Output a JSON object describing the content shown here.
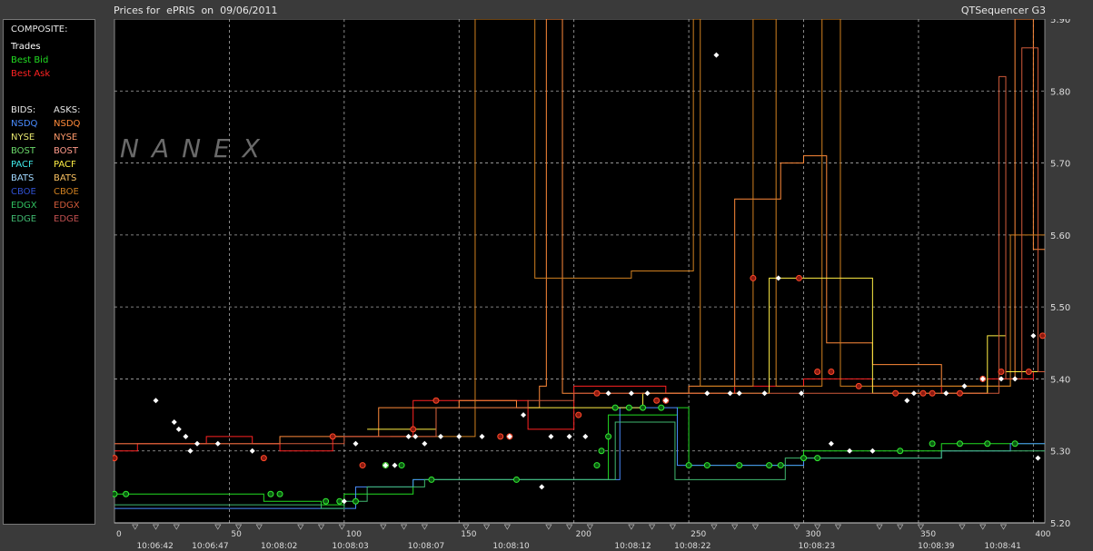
{
  "header": {
    "title": "Prices for  ePRIS  on  09/06/2011",
    "app": "QTSequencer G3"
  },
  "watermark": "NANEX",
  "legend": {
    "composite_title": "COMPOSITE:",
    "composite": [
      {
        "label": "Trades",
        "color": "#ffffff"
      },
      {
        "label": "Best Bid",
        "color": "#22dd22"
      },
      {
        "label": "Best Ask",
        "color": "#ff2222"
      }
    ],
    "bids_title": "BIDS:",
    "asks_title": "ASKS:",
    "exchanges": [
      {
        "bid": "NSDQ",
        "ask": "NSDQ",
        "bid_color": "#4a8cff",
        "ask_color": "#ff8a3a"
      },
      {
        "bid": "NYSE",
        "ask": "NYSE",
        "bid_color": "#e8e870",
        "ask_color": "#ff9a6a"
      },
      {
        "bid": "BOST",
        "ask": "BOST",
        "bid_color": "#6ad86a",
        "ask_color": "#ff9a8a"
      },
      {
        "bid": "PACF",
        "ask": "PACF",
        "bid_color": "#40e8e8",
        "ask_color": "#ffee44"
      },
      {
        "bid": "BATS",
        "ask": "BATS",
        "bid_color": "#a0d8ff",
        "ask_color": "#f8c060"
      },
      {
        "bid": "CBOE",
        "ask": "CBOE",
        "bid_color": "#3050d0",
        "ask_color": "#d08020"
      },
      {
        "bid": "EDGX",
        "ask": "EDGX",
        "bid_color": "#30c060",
        "ask_color": "#d05a3a"
      },
      {
        "bid": "EDGE",
        "ask": "EDGE",
        "bid_color": "#40b870",
        "ask_color": "#c05050"
      }
    ]
  },
  "chart_data": {
    "type": "line",
    "title": "Prices for  ePRIS  on  09/06/2011",
    "ylim": [
      5.2,
      5.9
    ],
    "xlim": [
      0,
      405
    ],
    "grid": true,
    "y_ticks": [
      "5.20",
      "5.30",
      "5.40",
      "5.50",
      "5.60",
      "5.70",
      "5.80",
      "5.90"
    ],
    "x_ticks": [
      0,
      50,
      100,
      150,
      200,
      250,
      300,
      350,
      400
    ],
    "time_labels": [
      {
        "x": 16,
        "label": "10:06:42"
      },
      {
        "x": 40,
        "label": "10:06:47"
      },
      {
        "x": 70,
        "label": "10:08:02"
      },
      {
        "x": 101,
        "label": "10:08:03"
      },
      {
        "x": 134,
        "label": "10:08:07"
      },
      {
        "x": 171,
        "label": "10:08:10"
      },
      {
        "x": 224,
        "label": "10:08:12"
      },
      {
        "x": 250,
        "label": "10:08:22"
      },
      {
        "x": 304,
        "label": "10:08:23"
      },
      {
        "x": 356,
        "label": "10:08:39"
      },
      {
        "x": 385,
        "label": "10:08:41"
      }
    ],
    "series": [
      {
        "name": "Best Ask",
        "color": "#ff2222",
        "values": [
          [
            0,
            5.3
          ],
          [
            10,
            5.31
          ],
          [
            40,
            5.32
          ],
          [
            60,
            5.31
          ],
          [
            72,
            5.3
          ],
          [
            95,
            5.32
          ],
          [
            130,
            5.37
          ],
          [
            180,
            5.33
          ],
          [
            200,
            5.39
          ],
          [
            240,
            5.38
          ],
          [
            270,
            5.39
          ],
          [
            300,
            5.4
          ],
          [
            330,
            5.39
          ],
          [
            360,
            5.38
          ],
          [
            380,
            5.4
          ],
          [
            400,
            5.41
          ],
          [
            405,
            5.41
          ]
        ]
      },
      {
        "name": "Best Bid",
        "color": "#22dd22",
        "values": [
          [
            0,
            5.24
          ],
          [
            60,
            5.24
          ],
          [
            65,
            5.23
          ],
          [
            90,
            5.225
          ],
          [
            100,
            5.24
          ],
          [
            130,
            5.26
          ],
          [
            160,
            5.26
          ],
          [
            200,
            5.26
          ],
          [
            215,
            5.35
          ],
          [
            245,
            5.36
          ],
          [
            250,
            5.28
          ],
          [
            280,
            5.28
          ],
          [
            300,
            5.3
          ],
          [
            340,
            5.3
          ],
          [
            360,
            5.31
          ],
          [
            380,
            5.31
          ],
          [
            405,
            5.31
          ]
        ]
      },
      {
        "name": "NSDQ Bid",
        "color": "#4a8cff",
        "values": [
          [
            0,
            5.22
          ],
          [
            100,
            5.22
          ],
          [
            105,
            5.25
          ],
          [
            130,
            5.26
          ],
          [
            215,
            5.26
          ],
          [
            220,
            5.36
          ],
          [
            240,
            5.36
          ],
          [
            245,
            5.28
          ],
          [
            300,
            5.29
          ],
          [
            360,
            5.3
          ],
          [
            390,
            5.31
          ],
          [
            405,
            5.31
          ]
        ]
      },
      {
        "name": "EDGE Bid",
        "color": "#40b870",
        "values": [
          [
            0,
            5.225
          ],
          [
            60,
            5.225
          ],
          [
            90,
            5.22
          ],
          [
            100,
            5.23
          ],
          [
            110,
            5.25
          ],
          [
            135,
            5.26
          ],
          [
            212,
            5.26
          ],
          [
            218,
            5.34
          ],
          [
            242,
            5.34
          ],
          [
            244,
            5.26
          ],
          [
            290,
            5.26
          ],
          [
            292,
            5.29
          ],
          [
            340,
            5.29
          ],
          [
            360,
            5.3
          ],
          [
            405,
            5.3
          ]
        ]
      },
      {
        "name": "NSDQ Ask",
        "color": "#ff8a3a",
        "values": [
          [
            0,
            5.31
          ],
          [
            50,
            5.31
          ],
          [
            72,
            5.32
          ],
          [
            100,
            5.32
          ],
          [
            115,
            5.36
          ],
          [
            150,
            5.37
          ],
          [
            175,
            5.36
          ],
          [
            185,
            5.39
          ],
          [
            188,
            5.9
          ],
          [
            192,
            5.9
          ],
          [
            195,
            5.38
          ],
          [
            240,
            5.38
          ],
          [
            250,
            5.39
          ],
          [
            270,
            5.65
          ],
          [
            290,
            5.7
          ],
          [
            300,
            5.71
          ],
          [
            310,
            5.45
          ],
          [
            330,
            5.42
          ],
          [
            360,
            5.39
          ],
          [
            390,
            5.4
          ],
          [
            392,
            5.9
          ],
          [
            396,
            5.9
          ],
          [
            400,
            5.58
          ],
          [
            405,
            5.58
          ]
        ]
      },
      {
        "name": "CBOE Ask",
        "color": "#d08020",
        "values": [
          [
            120,
            5.32
          ],
          [
            155,
            5.32
          ],
          [
            157,
            5.9
          ],
          [
            180,
            5.9
          ],
          [
            183,
            5.54
          ],
          [
            225,
            5.55
          ],
          [
            250,
            5.55
          ],
          [
            252,
            5.9
          ],
          [
            255,
            5.39
          ],
          [
            275,
            5.39
          ],
          [
            278,
            5.9
          ],
          [
            285,
            5.9
          ],
          [
            288,
            5.39
          ],
          [
            305,
            5.39
          ],
          [
            308,
            5.9
          ],
          [
            313,
            5.9
          ],
          [
            316,
            5.39
          ],
          [
            355,
            5.39
          ],
          [
            390,
            5.6
          ],
          [
            405,
            5.6
          ]
        ]
      },
      {
        "name": "PACF Ask",
        "color": "#ffee44",
        "values": [
          [
            110,
            5.33
          ],
          [
            130,
            5.33
          ],
          [
            140,
            5.36
          ],
          [
            175,
            5.36
          ],
          [
            185,
            5.36
          ],
          [
            230,
            5.38
          ],
          [
            270,
            5.38
          ],
          [
            285,
            5.54
          ],
          [
            325,
            5.54
          ],
          [
            330,
            5.38
          ],
          [
            375,
            5.38
          ],
          [
            380,
            5.46
          ],
          [
            385,
            5.46
          ],
          [
            388,
            5.41
          ],
          [
            405,
            5.41
          ]
        ]
      },
      {
        "name": "EDGX Ask",
        "color": "#d05a3a",
        "values": [
          [
            0,
            5.31
          ],
          [
            60,
            5.31
          ],
          [
            72,
            5.31
          ],
          [
            100,
            5.32
          ],
          [
            140,
            5.36
          ],
          [
            180,
            5.37
          ],
          [
            200,
            5.38
          ],
          [
            250,
            5.38
          ],
          [
            280,
            5.38
          ],
          [
            330,
            5.38
          ],
          [
            360,
            5.38
          ],
          [
            385,
            5.82
          ],
          [
            388,
            5.4
          ],
          [
            395,
            5.86
          ],
          [
            400,
            5.86
          ],
          [
            402,
            5.41
          ],
          [
            405,
            5.41
          ]
        ]
      }
    ],
    "trades": [
      [
        18,
        5.37
      ],
      [
        26,
        5.34
      ],
      [
        28,
        5.33
      ],
      [
        31,
        5.32
      ],
      [
        33,
        5.3
      ],
      [
        36,
        5.31
      ],
      [
        45,
        5.31
      ],
      [
        60,
        5.3
      ],
      [
        100,
        5.23
      ],
      [
        105,
        5.31
      ],
      [
        118,
        5.28
      ],
      [
        122,
        5.28
      ],
      [
        128,
        5.32
      ],
      [
        131,
        5.32
      ],
      [
        135,
        5.31
      ],
      [
        142,
        5.32
      ],
      [
        150,
        5.32
      ],
      [
        160,
        5.32
      ],
      [
        172,
        5.32
      ],
      [
        178,
        5.35
      ],
      [
        186,
        5.25
      ],
      [
        190,
        5.32
      ],
      [
        198,
        5.32
      ],
      [
        205,
        5.32
      ],
      [
        215,
        5.38
      ],
      [
        225,
        5.38
      ],
      [
        232,
        5.38
      ],
      [
        240,
        5.37
      ],
      [
        258,
        5.38
      ],
      [
        262,
        5.85
      ],
      [
        268,
        5.38
      ],
      [
        272,
        5.38
      ],
      [
        283,
        5.38
      ],
      [
        289,
        5.54
      ],
      [
        299,
        5.38
      ],
      [
        312,
        5.31
      ],
      [
        320,
        5.3
      ],
      [
        330,
        5.3
      ],
      [
        345,
        5.37
      ],
      [
        348,
        5.38
      ],
      [
        362,
        5.38
      ],
      [
        370,
        5.39
      ],
      [
        378,
        5.4
      ],
      [
        386,
        5.4
      ],
      [
        392,
        5.4
      ],
      [
        400,
        5.46
      ],
      [
        402,
        5.29
      ]
    ],
    "ask_markers": [
      [
        0,
        5.29
      ],
      [
        65,
        5.29
      ],
      [
        95,
        5.32
      ],
      [
        108,
        5.28
      ],
      [
        118,
        5.28
      ],
      [
        130,
        5.33
      ],
      [
        140,
        5.37
      ],
      [
        168,
        5.32
      ],
      [
        172,
        5.32
      ],
      [
        202,
        5.35
      ],
      [
        210,
        5.38
      ],
      [
        236,
        5.37
      ],
      [
        240,
        5.37
      ],
      [
        278,
        5.54
      ],
      [
        298,
        5.54
      ],
      [
        306,
        5.41
      ],
      [
        312,
        5.41
      ],
      [
        324,
        5.39
      ],
      [
        340,
        5.38
      ],
      [
        352,
        5.38
      ],
      [
        356,
        5.38
      ],
      [
        368,
        5.38
      ],
      [
        378,
        5.4
      ],
      [
        386,
        5.41
      ],
      [
        398,
        5.41
      ],
      [
        404,
        5.46
      ]
    ],
    "bid_markers": [
      [
        0,
        5.24
      ],
      [
        5,
        5.24
      ],
      [
        68,
        5.24
      ],
      [
        72,
        5.24
      ],
      [
        92,
        5.23
      ],
      [
        98,
        5.23
      ],
      [
        105,
        5.23
      ],
      [
        118,
        5.28
      ],
      [
        125,
        5.28
      ],
      [
        138,
        5.26
      ],
      [
        175,
        5.26
      ],
      [
        210,
        5.28
      ],
      [
        212,
        5.3
      ],
      [
        215,
        5.32
      ],
      [
        218,
        5.36
      ],
      [
        224,
        5.36
      ],
      [
        230,
        5.36
      ],
      [
        238,
        5.36
      ],
      [
        250,
        5.28
      ],
      [
        258,
        5.28
      ],
      [
        272,
        5.28
      ],
      [
        285,
        5.28
      ],
      [
        290,
        5.28
      ],
      [
        300,
        5.29
      ],
      [
        306,
        5.29
      ],
      [
        342,
        5.3
      ],
      [
        356,
        5.31
      ],
      [
        368,
        5.31
      ],
      [
        380,
        5.31
      ],
      [
        392,
        5.31
      ]
    ]
  }
}
